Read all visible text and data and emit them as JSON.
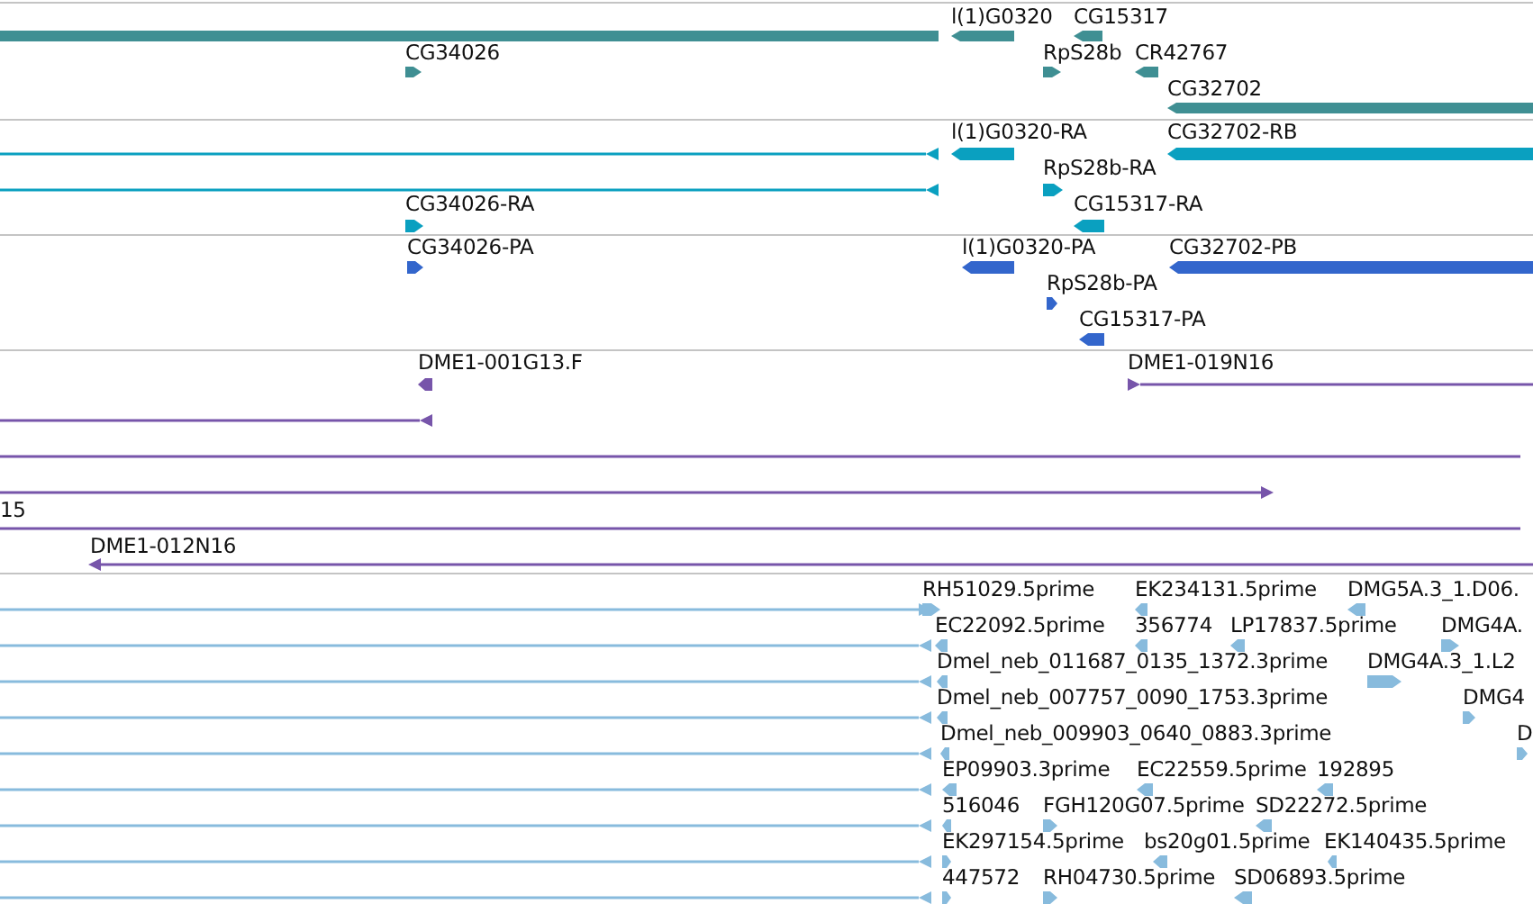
{
  "tracks": [
    {
      "kind": "gene",
      "features": [
        {
          "kind": "block"
        },
        {
          "kind": "block",
          "label": "l(1)G0320",
          "reverse": true
        },
        {
          "kind": "block",
          "label": "CG15317",
          "reverse": true
        },
        {
          "kind": "block",
          "label": "CG34026",
          "reverse": false
        },
        {
          "kind": "block",
          "label": "RpS28b",
          "reverse": false
        },
        {
          "kind": "block",
          "label": "CR42767",
          "reverse": true
        },
        {
          "kind": "block",
          "label": "CG32702",
          "reverse": true
        }
      ]
    },
    {
      "kind": "transcript",
      "features": [
        {
          "kind": "line",
          "reverse": true
        },
        {
          "kind": "block",
          "label": "l(1)G0320-RA",
          "reverse": true
        },
        {
          "kind": "block",
          "label": "CG32702-RB",
          "reverse": true
        },
        {
          "kind": "line",
          "reverse": true
        },
        {
          "kind": "block",
          "label": "RpS28b-RA",
          "reverse": false
        },
        {
          "kind": "block",
          "label": "CG34026-RA",
          "reverse": false
        },
        {
          "kind": "block",
          "label": "CG15317-RA",
          "reverse": true
        }
      ]
    },
    {
      "kind": "protein",
      "features": [
        {
          "kind": "block",
          "label": "CG34026-PA",
          "reverse": false
        },
        {
          "kind": "block",
          "label": "l(1)G0320-PA",
          "reverse": true
        },
        {
          "kind": "block",
          "label": "CG32702-PB",
          "reverse": true
        },
        {
          "kind": "block",
          "label": "RpS28b-PA",
          "reverse": false
        },
        {
          "kind": "block",
          "label": "CG15317-PA",
          "reverse": true
        }
      ]
    },
    {
      "kind": "clone",
      "features": [
        {
          "kind": "block",
          "label": "DME1-001G13.F",
          "reverse": true
        },
        {
          "kind": "line",
          "label": "DME1-019N16",
          "reverse": false
        },
        {
          "kind": "line",
          "reverse": true
        },
        {
          "kind": "line"
        },
        {
          "kind": "line",
          "reverse": false
        },
        {
          "kind": "line",
          "label": "15"
        },
        {
          "kind": "line",
          "label": "DME1-012N16",
          "reverse": true
        }
      ]
    },
    {
      "kind": "est",
      "features": [
        {
          "kind": "line",
          "reverse": false
        },
        {
          "kind": "block",
          "label": "RH51029.5prime",
          "reverse": false
        },
        {
          "kind": "block",
          "label": "EK234131.5prime",
          "reverse": true
        },
        {
          "kind": "block",
          "label": "DMG5A.3_1.D06.",
          "reverse": true
        },
        {
          "kind": "line",
          "reverse": true
        },
        {
          "kind": "block",
          "label": "EC22092.5prime",
          "reverse": true
        },
        {
          "kind": "block",
          "label": "356774",
          "reverse": true
        },
        {
          "kind": "block",
          "label": "LP17837.5prime",
          "reverse": true
        },
        {
          "kind": "block",
          "label": "DMG4A.",
          "reverse": false
        },
        {
          "kind": "line",
          "reverse": true
        },
        {
          "kind": "block",
          "label": "Dmel_neb_011687_0135_1372.3prime",
          "reverse": true
        },
        {
          "kind": "block",
          "label": "DMG4A.3_1.L2",
          "reverse": false
        },
        {
          "kind": "line",
          "reverse": true
        },
        {
          "kind": "block",
          "label": "Dmel_neb_007757_0090_1753.3prime",
          "reverse": true
        },
        {
          "kind": "block",
          "label": "DMG4",
          "reverse": false
        },
        {
          "kind": "line",
          "reverse": true
        },
        {
          "kind": "block",
          "label": "Dmel_neb_009903_0640_0883.3prime",
          "reverse": true
        },
        {
          "kind": "block",
          "label": "D",
          "reverse": false
        },
        {
          "kind": "line",
          "reverse": true
        },
        {
          "kind": "block",
          "label": "EP09903.3prime",
          "reverse": true
        },
        {
          "kind": "block",
          "label": "EC22559.5prime",
          "reverse": true
        },
        {
          "kind": "block",
          "label": "192895",
          "reverse": true
        },
        {
          "kind": "line",
          "reverse": true
        },
        {
          "kind": "block",
          "label": "516046",
          "reverse": true
        },
        {
          "kind": "block",
          "label": "FGH120G07.5prime",
          "reverse": false
        },
        {
          "kind": "block",
          "label": "SD22272.5prime",
          "reverse": true
        },
        {
          "kind": "line",
          "reverse": true
        },
        {
          "kind": "block",
          "label": "EK297154.5prime",
          "reverse": false
        },
        {
          "kind": "block",
          "label": "bs20g01.5prime",
          "reverse": true
        },
        {
          "kind": "block",
          "label": "EK140435.5prime",
          "reverse": true
        },
        {
          "kind": "line",
          "reverse": true
        },
        {
          "kind": "block",
          "label": "447572",
          "reverse": false
        },
        {
          "kind": "block",
          "label": "RH04730.5prime",
          "reverse": false
        },
        {
          "kind": "block",
          "label": "SD06893.5prime",
          "reverse": true
        }
      ]
    }
  ]
}
